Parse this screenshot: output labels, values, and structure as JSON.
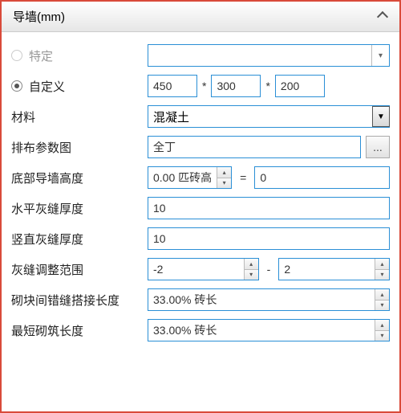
{
  "header": {
    "title": "导墙(mm)"
  },
  "mode": {
    "specific_label": "特定",
    "custom_label": "自定义"
  },
  "custom_dims": {
    "w": "450",
    "h": "300",
    "d": "200"
  },
  "rows": {
    "material": {
      "label": "材料",
      "value": "混凝土"
    },
    "pattern": {
      "label": "排布参数图",
      "value": "全丁"
    },
    "bottom_height": {
      "label": "底部导墙高度",
      "value": "0.00 匹砖高",
      "extra": "0"
    },
    "horiz_joint": {
      "label": "水平灰缝厚度",
      "value": "10"
    },
    "vert_joint": {
      "label": "竖直灰缝厚度",
      "value": "10"
    },
    "joint_range": {
      "label": "灰缝调整范围",
      "low": "-2",
      "high": "2"
    },
    "overlap": {
      "label": "砌块间错缝搭接长度",
      "value": "33.00% 砖长"
    },
    "min_len": {
      "label": "最短砌筑长度",
      "value": "33.00% 砖长"
    }
  },
  "sym": {
    "eq": "="
  }
}
